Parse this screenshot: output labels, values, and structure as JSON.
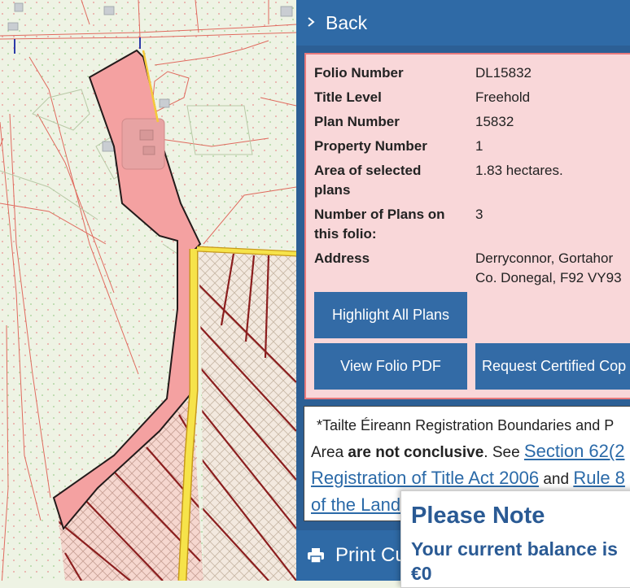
{
  "panel": {
    "back_label": "Back",
    "back_icon": "chevron-right-icon",
    "info": {
      "folio_number_label": "Folio Number",
      "folio_number": "DL15832",
      "title_level_label": "Title Level",
      "title_level": "Freehold",
      "plan_number_label": "Plan Number",
      "plan_number": "15832",
      "property_number_label": "Property Number",
      "property_number": "1",
      "area_label_1": "Area of selected",
      "area_label_2": "plans",
      "area": "1.83 hectares.",
      "plans_label_1": "Number of Plans on",
      "plans_label_2": "this folio:",
      "plans_count": "3",
      "address_label": "Address",
      "address_line1": "Derryconnor, Gortahor",
      "address_line2": "Co. Donegal, F92 VY93"
    },
    "buttons": {
      "highlight_all": "Highlight All Plans",
      "view_pdf": "View Folio PDF",
      "request_certified": "Request Certified Cop"
    },
    "disclaimer": {
      "line1": "*Tailte Éireann Registration Boundaries and P",
      "area_word": "Area",
      "bold_phrase": "are not conclusive",
      "see": ". See",
      "section_link": "Section 62(2",
      "act_link": "Registration of Title Act 2006",
      "and_word": "and",
      "rule_link": "Rule 8",
      "land_link": "of the Land"
    },
    "print_label": "Print Cu",
    "print_icon": "printer-icon"
  },
  "note": {
    "title": "Please Note",
    "body_line1": "Your current balance is",
    "body_line2": "€0"
  },
  "colors": {
    "panel_bg": "#2c5f95",
    "bar_bg": "#2f6aa6",
    "card_bg": "#f9d7d9",
    "card_border": "#e8797c",
    "button_bg": "#336ba6",
    "link": "#2b6aa8",
    "note_text": "#2a5a94",
    "selected_plot": "#f4a1a1",
    "road_yellow": "#f6e34a",
    "boundary_red": "#8b1e1e"
  }
}
